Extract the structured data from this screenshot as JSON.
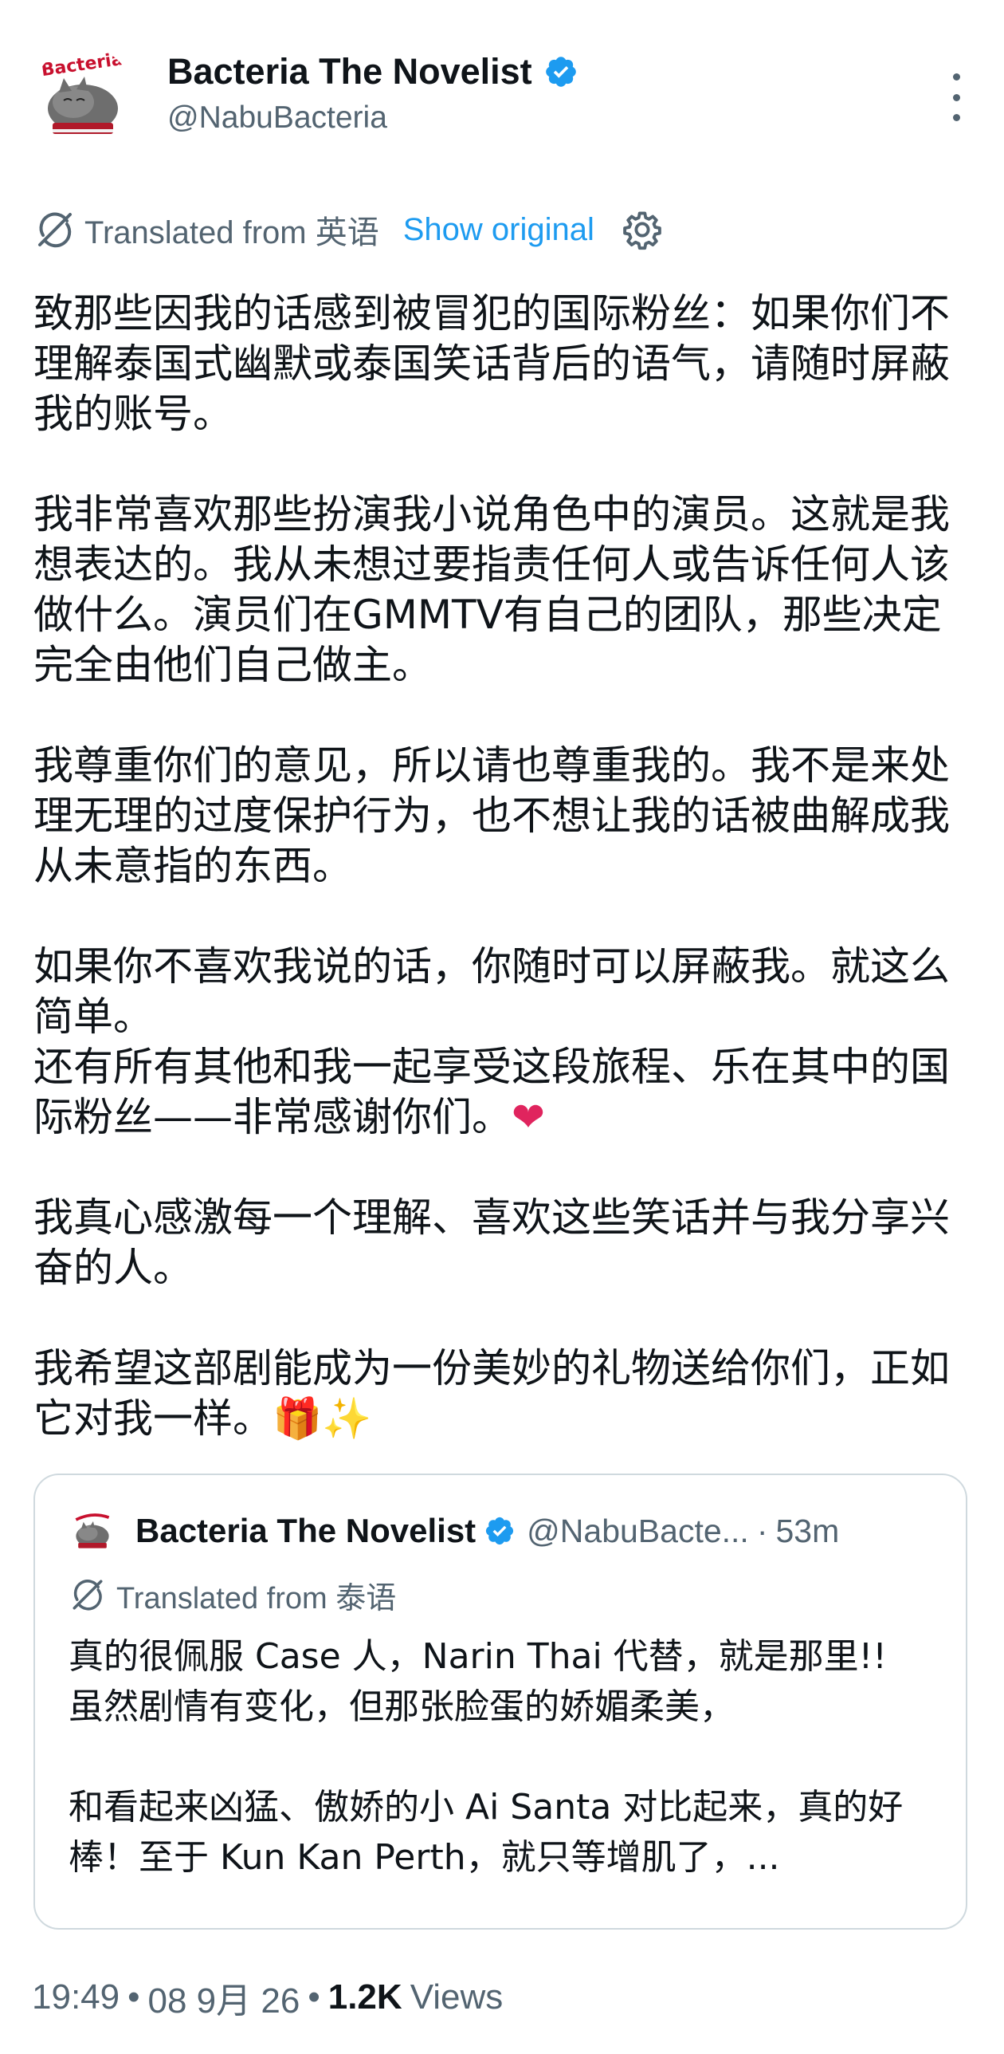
{
  "author": {
    "display_name": "Bacteria The Novelist",
    "handle": "@NabuBacteria",
    "avatar_text": "Bacteria",
    "verified": true
  },
  "translation": {
    "label": "Translated from 英语",
    "show_original": "Show original"
  },
  "tweet": {
    "paragraphs": [
      "致那些因我的话感到被冒犯的国际粉丝：如果你们不理解泰国式幽默或泰国笑话背后的语气，请随时屏蔽我的账号。",
      "我非常喜欢那些扮演我小说角色中的演员。这就是我想表达的。我从未想过要指责任何人或告诉任何人该做什么。演员们在GMMTV有自己的团队，那些决定完全由他们自己做主。",
      "我尊重你们的意见，所以请也尊重我的。我不是来处理无理的过度保护行为，也不想让我的话被曲解成我从未意指的东西。",
      "如果你不喜欢我说的话，你随时可以屏蔽我。就这么简单。",
      "还有所有其他和我一起享受这段旅程、乐在其中的国际粉丝——非常感谢你们。",
      "我真心感激每一个理解、喜欢这些笑话并与我分享兴奋的人。",
      "我希望这部剧能成为一份美妙的礼物送给你们，正如它对我一样。"
    ],
    "emoji_heart": "❤",
    "emoji_gift": "🎁",
    "emoji_sparkles": "✨"
  },
  "quote": {
    "display_name": "Bacteria The Novelist",
    "handle": "@NabuBacte...",
    "dot": "·",
    "time": "53m",
    "translation_label": "Translated from 泰语",
    "paragraphs": [
      "真的很佩服 Case 人，Narin Thai 代替，就是那里!!\n虽然剧情有变化，但那张脸蛋的娇媚柔美，",
      "和看起来凶猛、傲娇的小 Ai Santa 对比起来，真的好棒！至于 Kun Kan Perth，就只等增肌了，..."
    ]
  },
  "meta": {
    "time": "19:49",
    "sep": "•",
    "date": "08 9月 26",
    "views_count": "1.2K",
    "views_label": "Views"
  },
  "colors": {
    "accent": "#1d9bf0",
    "secondary_text": "#536471",
    "border": "#cfd9de",
    "heart": "#e0245e"
  },
  "icons": {
    "verified": "verified-badge-icon",
    "translate": "translate-icon",
    "settings": "gear-icon",
    "more": "more-dots-icon"
  }
}
